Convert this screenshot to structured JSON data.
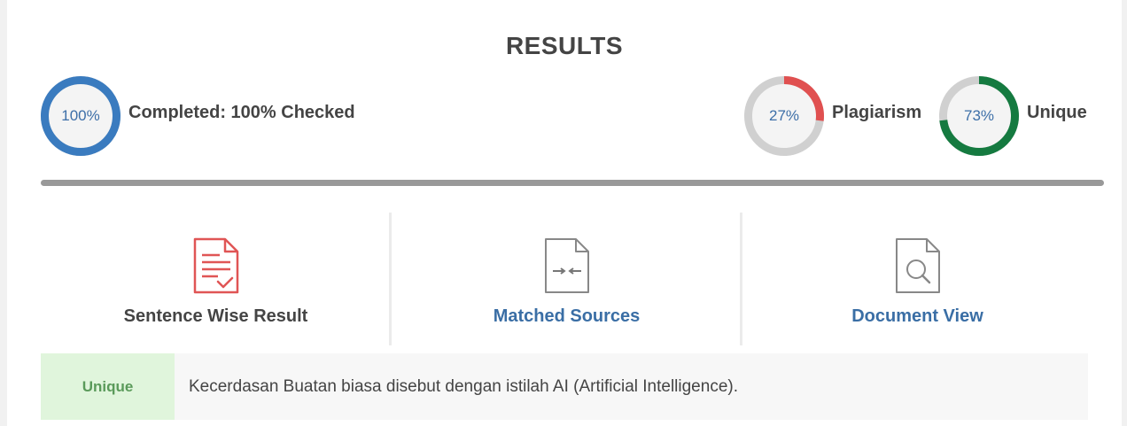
{
  "title": "RESULTS",
  "completion": {
    "percent_text": "100%",
    "progress": 1.0,
    "label": "Completed: 100% Checked",
    "color": "#3a7bbf"
  },
  "plagiarism": {
    "percent_text": "27%",
    "progress": 0.27,
    "label": "Plagiarism",
    "color": "#e05050"
  },
  "unique": {
    "percent_text": "73%",
    "progress": 0.73,
    "label": "Unique",
    "color": "#157a40"
  },
  "tabs": [
    {
      "label": "Sentence Wise Result",
      "icon": "document-check-icon",
      "active": true
    },
    {
      "label": "Matched Sources",
      "icon": "document-compare-icon",
      "active": false
    },
    {
      "label": "Document View",
      "icon": "document-search-icon",
      "active": false
    }
  ],
  "results": [
    {
      "status": "Unique",
      "text": "Kecerdasan Buatan biasa disebut dengan istilah AI (Artificial Intelligence)."
    }
  ]
}
